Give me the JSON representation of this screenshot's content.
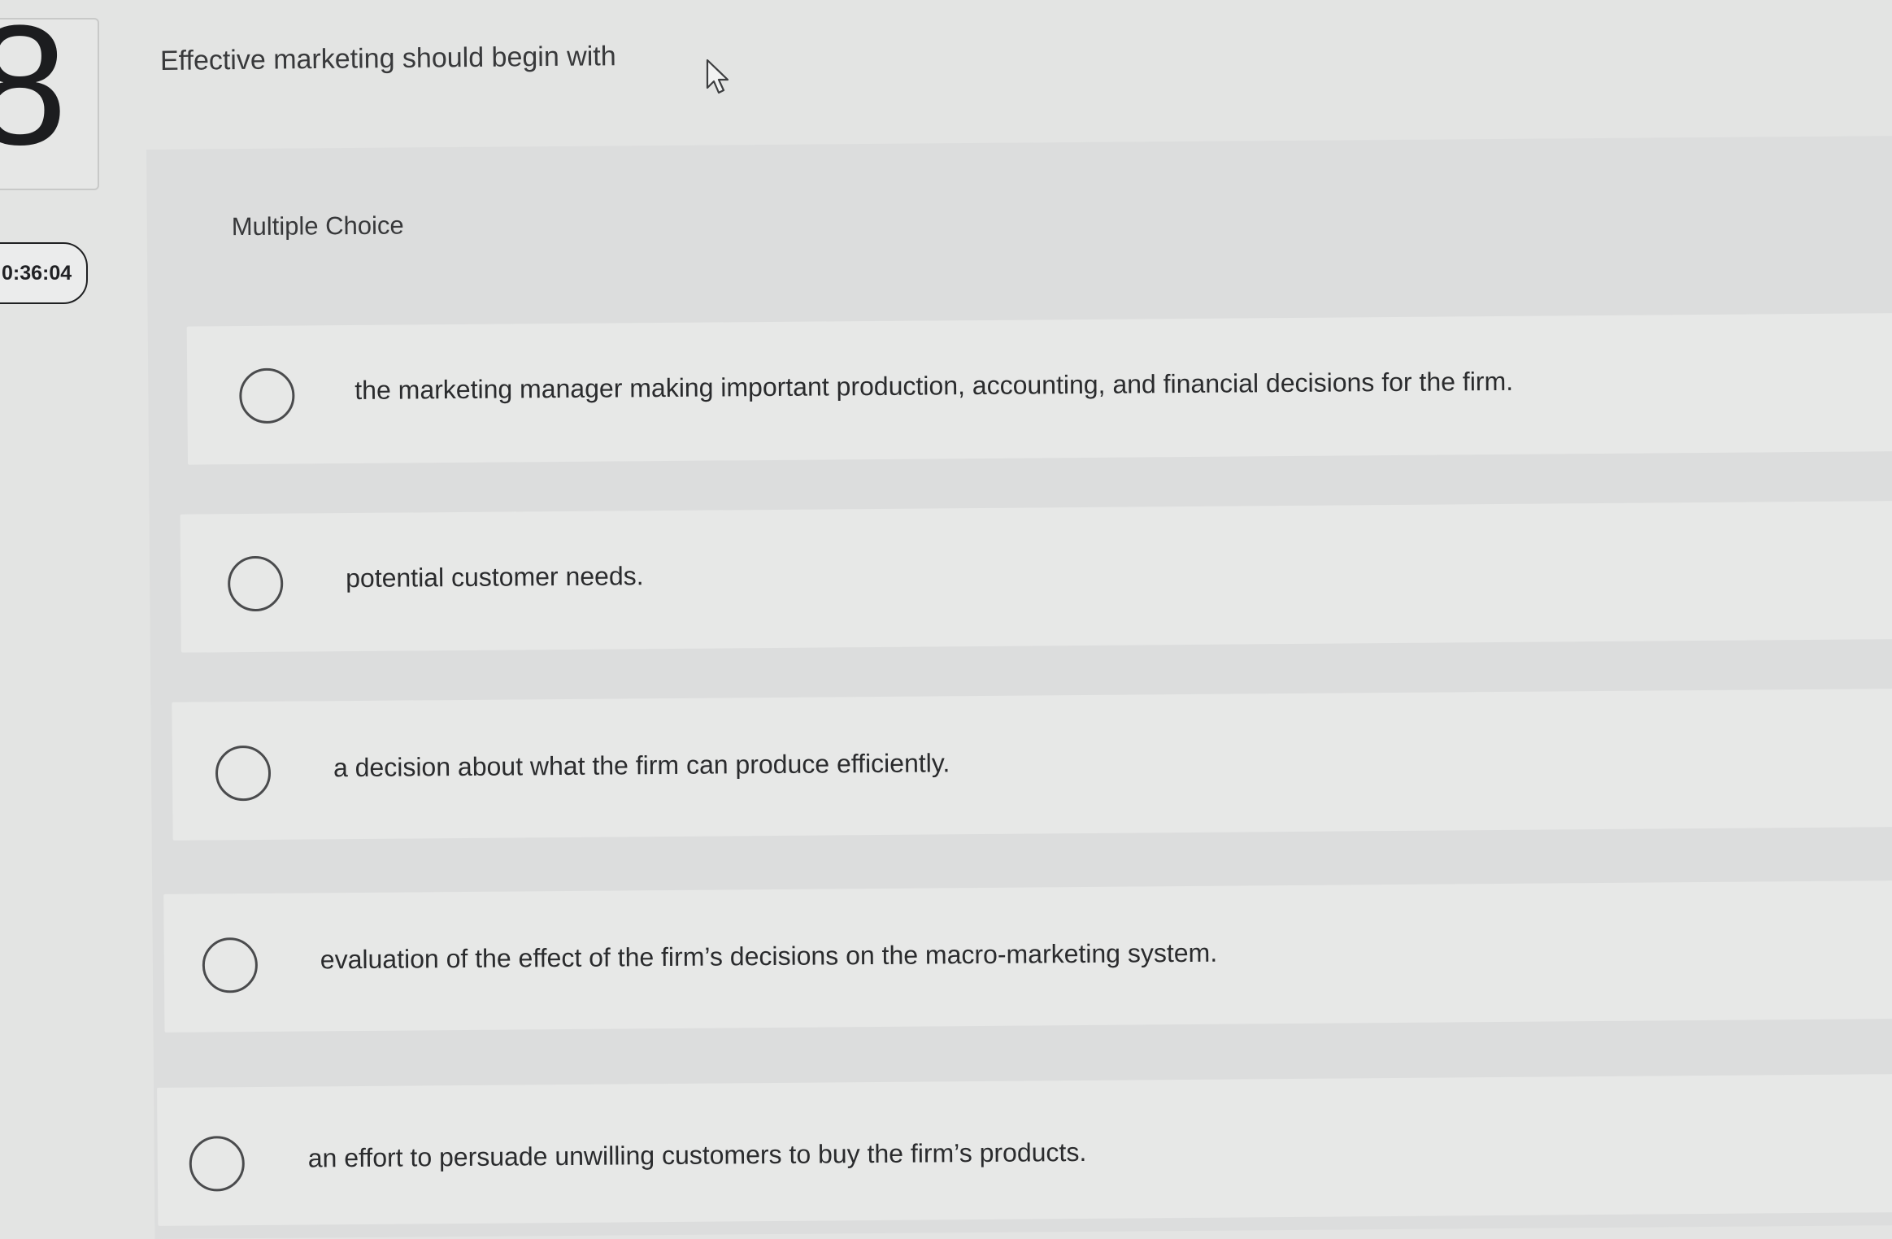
{
  "question": {
    "number": "8",
    "timer": "0:36:04",
    "prompt": "Effective marketing should begin with",
    "type_label": "Multiple Choice"
  },
  "choices": [
    {
      "label": "the marketing manager making important production, accounting, and financial decisions for the firm."
    },
    {
      "label": "potential customer needs."
    },
    {
      "label": "a decision about what the firm can produce efficiently."
    },
    {
      "label": "evaluation of the effect of the firm’s decisions on the macro-marketing system."
    },
    {
      "label": "an effort to persuade unwilling customers to buy the firm’s products."
    }
  ],
  "icons": {
    "cursor": "mouse-pointer-icon",
    "radio": "radio-button-empty"
  },
  "colors": {
    "background": "#e3e4e3",
    "panel": "#dcdddd",
    "choice_row": "#e7e8e7",
    "text": "#2e2f31"
  }
}
